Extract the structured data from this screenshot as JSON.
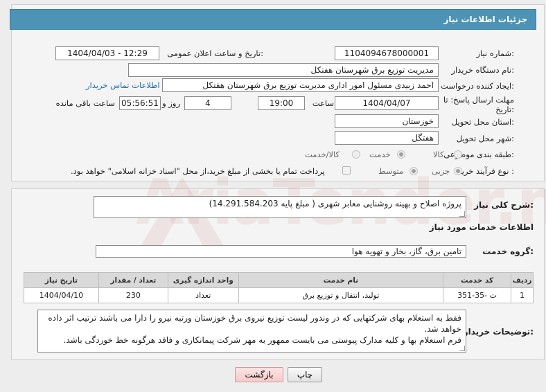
{
  "header": {
    "title": "جزئیات اطلاعات نیاز"
  },
  "fields": {
    "need_number_label": "شماره نیاز:",
    "need_number": "1104094678000001",
    "announce_label": "تاریخ و ساعت اعلان عمومی:",
    "announce_value": "1404/04/03 - 12:29",
    "buyer_org_label": "نام دستگاه خریدار:",
    "buyer_org": "مدیریت توزیع برق شهرستان هفتکل",
    "creator_label": "ایجاد کننده درخواست:",
    "creator": "احمد زبیدی مسئول امور اداری مدیریت توزیع برق شهرستان هفتکل",
    "contact_link": "اطلاعات تماس خریدار",
    "deadline_label_1": "مهلت ارسال پاسخ: تا",
    "deadline_label_2": "تاریخ:",
    "deadline_date": "1404/04/07",
    "time_label": "ساعت",
    "deadline_time": "19:00",
    "days_value": "4",
    "days_label": "روز و",
    "remaining_time": "05:56:51",
    "remaining_label": "ساعت باقی مانده",
    "province_label": "استان محل تحویل:",
    "province": "خوزستان",
    "city_label": "شهر محل تحویل:",
    "city": "هفتگل",
    "category_label": "طبقه بندی موضوعی:",
    "category_options": [
      "کالا",
      "خدمت",
      "کالا/خدمت"
    ],
    "category_selected": "خدمت",
    "process_label": "نوع فرآیند خرید :",
    "process_options": [
      "جزیی",
      "متوسط"
    ],
    "process_selected": "جزیی",
    "treasury_note": "پرداخت تمام یا بخشی از مبلغ خرید،از محل \"اسناد خزانه اسلامی\" خواهد بود."
  },
  "summary": {
    "label": "شرح کلی نیاز:",
    "text": "پروژه اصلاح و بهینه روشنایی معابر شهری ( مبلغ پایه 14.291.584.203)"
  },
  "services": {
    "section_title": "اطلاعات خدمات مورد نیاز",
    "group_label": "گروه خدمت:",
    "group_value": "تامین برق، گاز، بخار و تهویه هوا",
    "columns": [
      "ردیف",
      "کد خدمت",
      "نام خدمت",
      "واحد اندازه گیری",
      "تعداد / مقدار",
      "تاریخ نیاز"
    ],
    "rows": [
      {
        "index": "1",
        "code": "ت -35-351",
        "name": "تولید، انتقال و توزیع برق",
        "unit": "تعداد",
        "qty": "230",
        "date": "1404/04/10"
      }
    ]
  },
  "buyer_notes": {
    "label": "توضیحات خریدار:",
    "line1": "فقط به استعلام بهای شرکتهایی که در وندور لیست توزیع نیروی برق خوزستان ورتبه نیرو را دارا می باشند ترتیب اثر داده خواهد شد.",
    "line2": "فرم استعلام بها و کلیه مدارک پیوستی می بایست ممهور به مهر شرکت پیمانکاری و فاقد هرگونه خط خوردگی باشد."
  },
  "buttons": {
    "print": "چاپ",
    "back": "بازگشت"
  },
  "watermark": "AriaTender.neT",
  "colors": {
    "header_bg": "#4c93b5",
    "link": "#1f6fb3",
    "back_button": "#f6caca"
  }
}
